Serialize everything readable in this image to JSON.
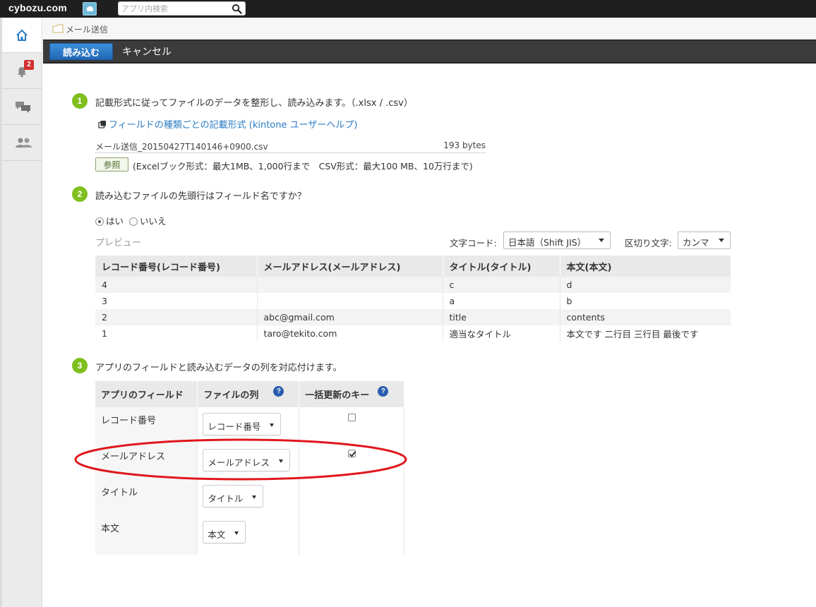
{
  "brand": {
    "logo": "cybozu.com"
  },
  "search": {
    "placeholder": "アプリ内検索"
  },
  "nav": {
    "notification_count": "2"
  },
  "breadcrumb": {
    "label": "メール送信"
  },
  "toolbar": {
    "import_label": "読み込む",
    "cancel_label": "キャンセル"
  },
  "step1": {
    "number": "1",
    "text": "記載形式に従ってファイルのデータを整形し、読み込みます。（.xlsx / .csv）",
    "help_link": "フィールドの種類ごとの記載形式 (kintone ユーザーヘルプ)",
    "file_name": "メール送信_20150427T140146+0900.csv",
    "file_size": "193 bytes",
    "browse_label": "参照",
    "limit_text": "(Excelブック形式：最大1MB、1,000行まで　CSV形式：最大100 MB、10万行まで)"
  },
  "step2": {
    "number": "2",
    "text": "読み込むファイルの先頭行はフィールド名ですか？",
    "yes_label": "はい",
    "no_label": "いいえ",
    "preview_label": "プレビュー",
    "encoding_label": "文字コード:",
    "encoding_value": "日本語（Shift JIS）",
    "delimiter_label": "区切り文字:",
    "delimiter_value": "カンマ"
  },
  "preview": {
    "headers": [
      "レコード番号(レコード番号)",
      "メールアドレス(メールアドレス)",
      "タイトル(タイトル)",
      "本文(本文)"
    ],
    "rows": [
      [
        "4",
        "",
        "c",
        "d"
      ],
      [
        "3",
        "",
        "a",
        "b"
      ],
      [
        "2",
        "abc@gmail.com",
        "title",
        "contents"
      ],
      [
        "1",
        "taro@tekito.com",
        "適当なタイトル",
        "本文です 二行目 三行目 最後です"
      ]
    ]
  },
  "step3": {
    "number": "3",
    "text": "アプリのフィールドと読み込むデータの列を対応付けます。",
    "headers": [
      "アプリのフィールド",
      "ファイルの列",
      "一括更新のキー"
    ],
    "help_glyph": "?",
    "rows": [
      {
        "field": "レコード番号",
        "column": "レコード番号",
        "key": false
      },
      {
        "field": "メールアドレス",
        "column": "メールアドレス",
        "key": true
      },
      {
        "field": "タイトル",
        "column": "タイトル",
        "key": false
      },
      {
        "field": "本文",
        "column": "本文",
        "key": false
      }
    ]
  },
  "colors": {
    "accent_blue": "#2168b8",
    "step_green": "#7fbf1e",
    "link": "#2a7bc4",
    "highlight_red": "#e0161c"
  }
}
